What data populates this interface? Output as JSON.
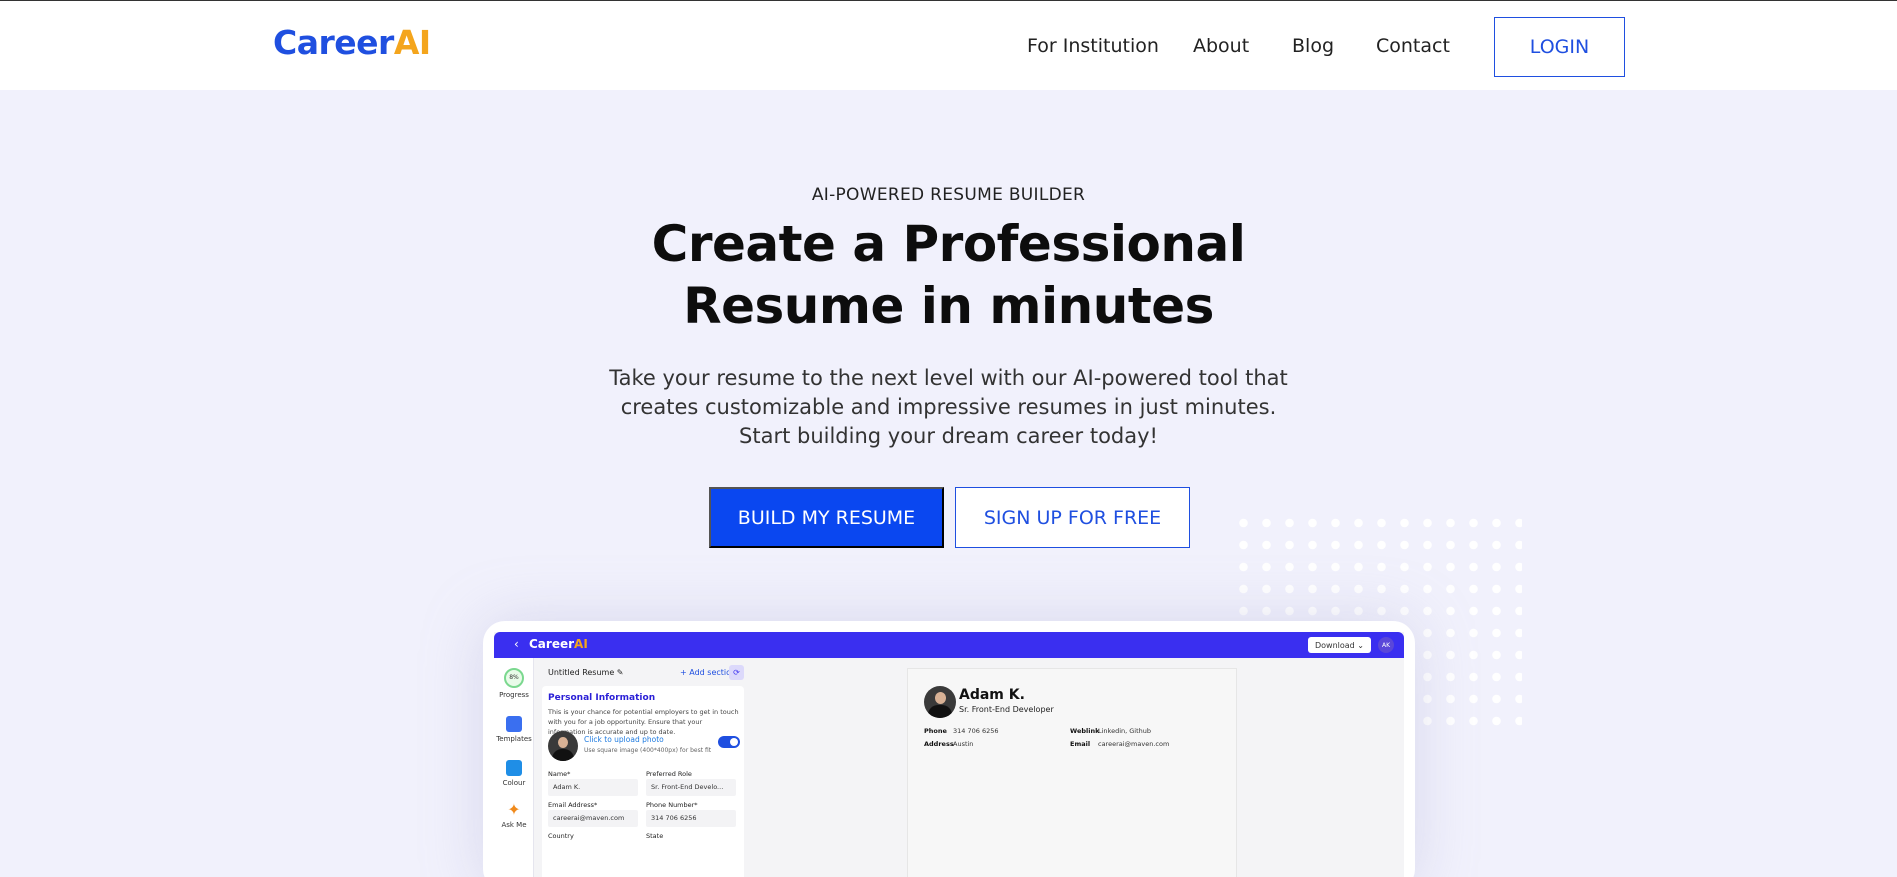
{
  "brand": {
    "part1": "Career",
    "part2": "AI",
    "color_primary": "#1f4fe0",
    "color_accent": "#f4a51c"
  },
  "nav": {
    "items": [
      "For Institution",
      "About",
      "Blog",
      "Contact"
    ],
    "login_label": "LOGIN"
  },
  "hero": {
    "eyebrow": "AI-POWERED RESUME BUILDER",
    "headline_line1": "Create a Professional",
    "headline_line2": "Resume in minutes",
    "sub_line1": "Take your resume to the next level with our AI-powered tool that",
    "sub_line2": "creates customizable and impressive resumes in just minutes.",
    "sub_line3": "Start building your dream career today!",
    "primary_cta": "BUILD MY RESUME",
    "secondary_cta": "SIGN UP FOR FREE"
  },
  "mockup": {
    "topbar": {
      "back": "‹",
      "logo_part1": "Career",
      "logo_part2": "AI",
      "download_label": "Download ⌄",
      "avatar_initials": "AK"
    },
    "rail": {
      "progress_value": "8%",
      "progress_label": "Progress",
      "templates_label": "Templates",
      "colour_label": "Colour",
      "ask_label": "Ask Me"
    },
    "form": {
      "title": "Untitled Resume ✎",
      "add_section": "+ Add section",
      "refresh": "⟳",
      "card_title": "Personal Information",
      "card_desc": "This is your chance for potential employers to get in touch with you for a job opportunity. Ensure that your information is accurate and up to date.",
      "upload_label": "Click to upload photo",
      "upload_hint": "Use square image (400*400px) for best fit",
      "name_label": "Name*",
      "name_value": "Adam K.",
      "role_label": "Preferred Role",
      "role_value": "Sr. Front-End Develo...",
      "email_label": "Email Address*",
      "email_value": "careerai@maven.com",
      "phone_label": "Phone Number*",
      "phone_value": "314 706 6256",
      "country_label": "Country",
      "state_label": "State"
    },
    "preview": {
      "name": "Adam K.",
      "role": "Sr. Front-End Developer",
      "phone_key": "Phone",
      "phone_value": "314 706 6256",
      "weblink_key": "Weblink",
      "weblink_value": "Linkedin, Github",
      "address_key": "Address",
      "address_value": "Austin",
      "email_key": "Email",
      "email_value": "careerai@maven.com"
    }
  }
}
